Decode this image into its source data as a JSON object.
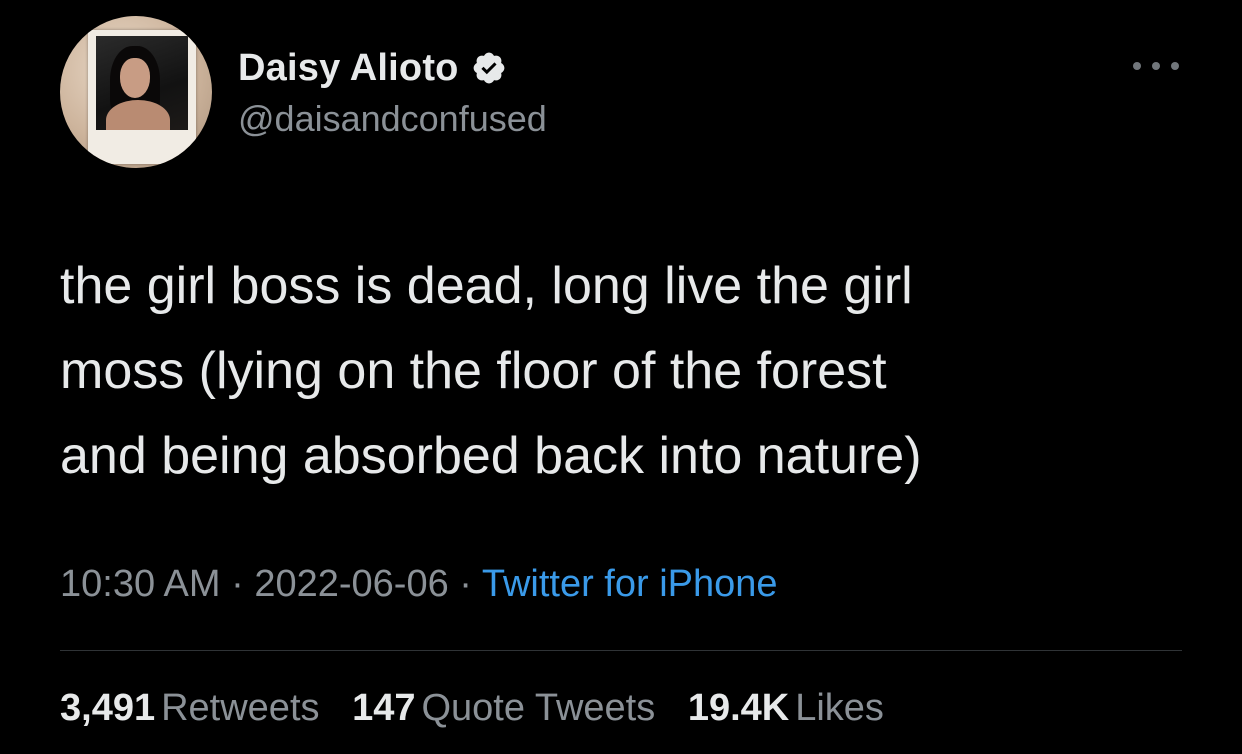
{
  "author": {
    "display_name": "Daisy Alioto",
    "handle": "@daisandconfused",
    "verified": true,
    "avatar_icon": "profile-photo-polaroid"
  },
  "tweet": {
    "text": "the girl boss is dead, long live the girl\nmoss (lying on the floor of the forest\nand being absorbed back into nature)"
  },
  "meta": {
    "time": "10:30 AM",
    "separator": "·",
    "date": "2022-06-06",
    "source": "Twitter for iPhone"
  },
  "stats": {
    "retweets_count": "3,491",
    "retweets_label": "Retweets",
    "quotes_count": "147",
    "quotes_label": "Quote Tweets",
    "likes_count": "19.4K",
    "likes_label": "Likes"
  },
  "colors": {
    "background": "#000000",
    "text_primary": "#e7e9ea",
    "text_secondary": "#8b9197",
    "link": "#3a9ae9",
    "divider": "#2f3336"
  },
  "icons": {
    "verified": "verified-badge-icon",
    "more": "more-options-icon"
  }
}
